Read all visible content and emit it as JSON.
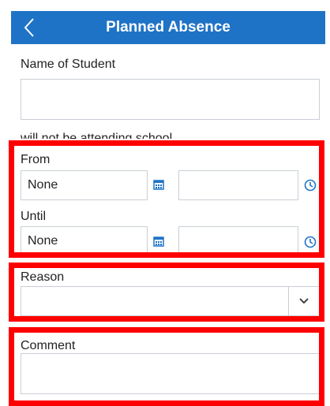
{
  "header": {
    "title": "Planned Absence",
    "back_icon": "chevron-left-icon",
    "color": "#1f73c6"
  },
  "form": {
    "student_label": "Name of Student",
    "student_value": "",
    "attending_text": "will not be attending school",
    "from_label": "From",
    "from_date": "None",
    "from_time": "",
    "until_label": "Until",
    "until_date": "None",
    "until_time": "",
    "reason_label": "Reason",
    "reason_value": "",
    "comment_label": "Comment",
    "comment_value": ""
  },
  "icons": {
    "calendar": "calendar-icon",
    "clock": "clock-icon",
    "dropdown": "chevron-down-icon"
  },
  "highlight_color": "#ff0000"
}
